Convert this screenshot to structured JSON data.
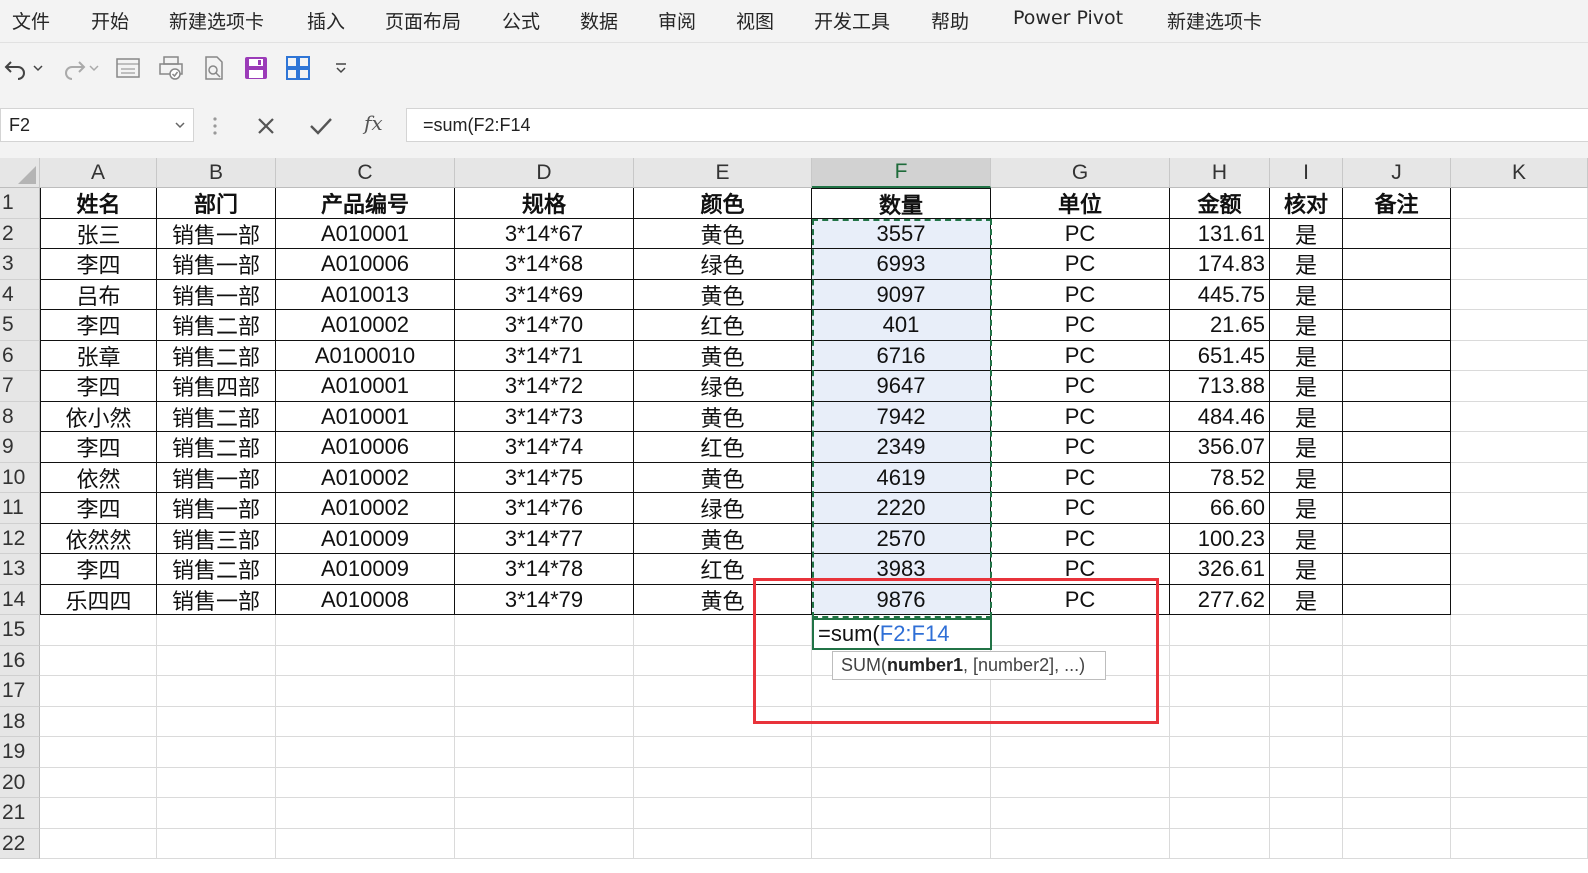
{
  "ribbon": {
    "tabs": [
      "文件",
      "开始",
      "新建选项卡",
      "插入",
      "页面布局",
      "公式",
      "数据",
      "审阅",
      "视图",
      "开发工具",
      "帮助",
      "Power Pivot",
      "新建选项卡"
    ]
  },
  "quick_access": {
    "icons": [
      "undo-icon",
      "redo-icon",
      "form-icon",
      "print-preview-icon",
      "document-icon",
      "save-icon",
      "grid-view-icon",
      "customize-dropdown-icon"
    ]
  },
  "formula_bar": {
    "name_box": "F2",
    "formula": "=sum(F2:F14"
  },
  "grid": {
    "columns": [
      "A",
      "B",
      "C",
      "D",
      "E",
      "F",
      "G",
      "H",
      "I",
      "J",
      "K"
    ],
    "row_numbers": [
      "1",
      "2",
      "3",
      "4",
      "5",
      "6",
      "7",
      "8",
      "9",
      "10",
      "11",
      "12",
      "13",
      "14",
      "15",
      "16",
      "17",
      "18",
      "19",
      "20",
      "21",
      "22"
    ],
    "selected_column": "F",
    "header_row": [
      "姓名",
      "部门",
      "产品编号",
      "规格",
      "颜色",
      "数量",
      "单位",
      "金额",
      "核对",
      "备注"
    ],
    "rows": [
      [
        "张三",
        "销售一部",
        "A010001",
        "3*14*67",
        "黄色",
        "3557",
        "PC",
        "131.61",
        "是",
        ""
      ],
      [
        "李四",
        "销售一部",
        "A010006",
        "3*14*68",
        "绿色",
        "6993",
        "PC",
        "174.83",
        "是",
        ""
      ],
      [
        "吕布",
        "销售一部",
        "A010013",
        "3*14*69",
        "黄色",
        "9097",
        "PC",
        "445.75",
        "是",
        ""
      ],
      [
        "李四",
        "销售二部",
        "A010002",
        "3*14*70",
        "红色",
        "401",
        "PC",
        "21.65",
        "是",
        ""
      ],
      [
        "张章",
        "销售二部",
        "A0100010",
        "3*14*71",
        "黄色",
        "6716",
        "PC",
        "651.45",
        "是",
        ""
      ],
      [
        "李四",
        "销售四部",
        "A010001",
        "3*14*72",
        "绿色",
        "9647",
        "PC",
        "713.88",
        "是",
        ""
      ],
      [
        "依小然",
        "销售二部",
        "A010001",
        "3*14*73",
        "黄色",
        "7942",
        "PC",
        "484.46",
        "是",
        ""
      ],
      [
        "李四",
        "销售二部",
        "A010006",
        "3*14*74",
        "红色",
        "2349",
        "PC",
        "356.07",
        "是",
        ""
      ],
      [
        "依然",
        "销售一部",
        "A010002",
        "3*14*75",
        "黄色",
        "4619",
        "PC",
        "78.52",
        "是",
        ""
      ],
      [
        "李四",
        "销售一部",
        "A010002",
        "3*14*76",
        "绿色",
        "2220",
        "PC",
        "66.60",
        "是",
        ""
      ],
      [
        "依然然",
        "销售三部",
        "A010009",
        "3*14*77",
        "黄色",
        "2570",
        "PC",
        "100.23",
        "是",
        ""
      ],
      [
        "李四",
        "销售二部",
        "A010009",
        "3*14*78",
        "红色",
        "3983",
        "PC",
        "326.61",
        "是",
        ""
      ],
      [
        "乐四四",
        "销售一部",
        "A010008",
        "3*14*79",
        "黄色",
        "9876",
        "PC",
        "277.62",
        "是",
        ""
      ]
    ],
    "editing_cell": {
      "ref": "F15",
      "prefix": "=sum(",
      "range_ref": "F2:F14"
    },
    "tooltip": {
      "fn": "SUM(",
      "arg1": "number1",
      "rest": ", [number2], ...)"
    }
  },
  "colors": {
    "selection": "#217346",
    "annotation": "#e8333b",
    "range_fill": "#e8eef9",
    "reference_text": "#2f6fd6"
  }
}
